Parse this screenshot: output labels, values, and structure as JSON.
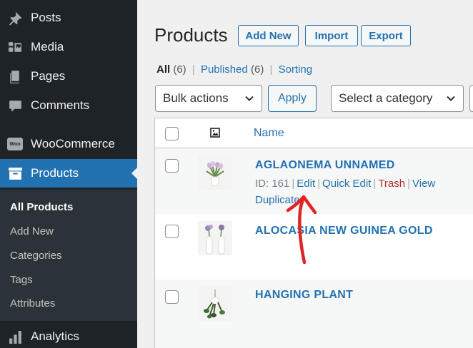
{
  "sidebar": {
    "items": [
      {
        "label": "Posts",
        "icon": "pin-icon"
      },
      {
        "label": "Media",
        "icon": "media-icon"
      },
      {
        "label": "Pages",
        "icon": "pages-icon"
      },
      {
        "label": "Comments",
        "icon": "comment-icon"
      },
      {
        "label": "WooCommerce",
        "icon": "woo-icon",
        "badge": "Woo"
      },
      {
        "label": "Products",
        "icon": "archive-icon"
      },
      {
        "label": "Analytics",
        "icon": "chart-bar-icon"
      }
    ],
    "submenu": [
      "All Products",
      "Add New",
      "Categories",
      "Tags",
      "Attributes"
    ]
  },
  "header": {
    "title": "Products",
    "buttons": [
      "Add New",
      "Import",
      "Export"
    ]
  },
  "filters": {
    "all_label": "All",
    "all_count": "(6)",
    "published_label": "Published",
    "published_count": "(6)",
    "sorting_label": "Sorting"
  },
  "bulk": {
    "select_value": "Bulk actions",
    "apply_label": "Apply",
    "category_value": "Select a category"
  },
  "table": {
    "name_header": "Name",
    "rows": [
      {
        "name": "AGLAONEMA UNNAMED",
        "id_text": "ID: 161",
        "actions": [
          "Edit",
          "Quick Edit",
          "Trash",
          "View",
          "Duplicate"
        ]
      },
      {
        "name": "ALOCASIA NEW GUINEA GOLD"
      },
      {
        "name": "HANGING PLANT"
      }
    ]
  },
  "colors": {
    "sidebar_bg": "#1d2327",
    "accent": "#2271b1",
    "annotation": "#e02424"
  }
}
